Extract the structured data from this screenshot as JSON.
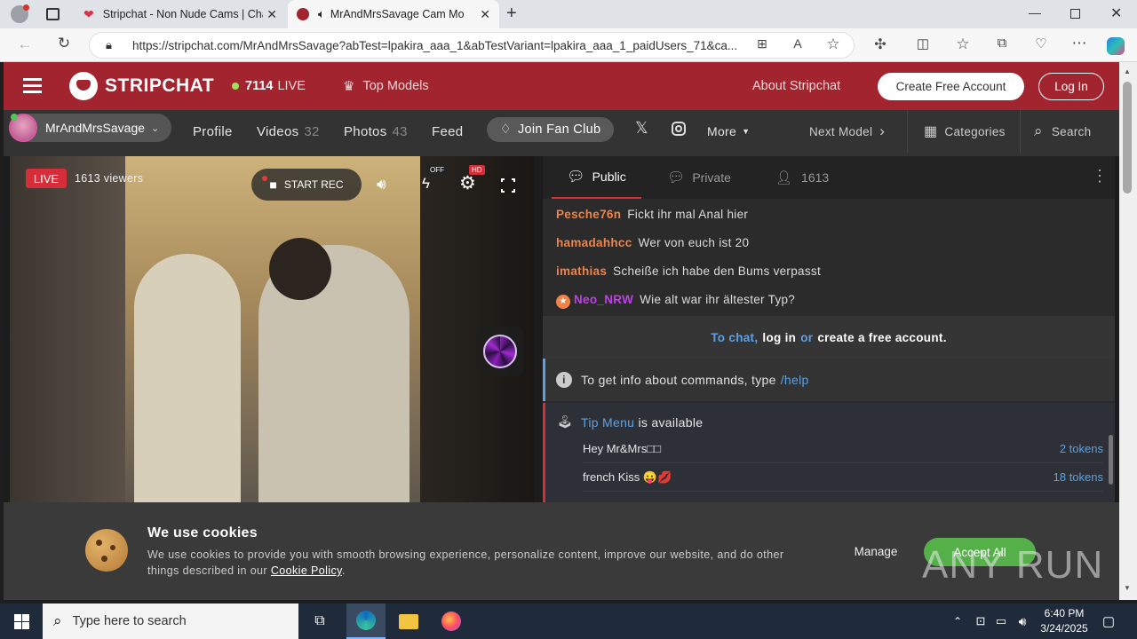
{
  "browser": {
    "tabs": [
      {
        "title": "Stripchat - Non Nude Cams | Cha"
      },
      {
        "title": "MrAndMrsSavage Cam Mod"
      }
    ],
    "url": "https://stripchat.com/MrAndMrsSavage?abTest=lpakira_aaa_1&abTestVariant=lpakira_aaa_1_paidUsers_71&ca..."
  },
  "header": {
    "logo": "STRIPCHAT",
    "live_count": "7114",
    "live_label": "LIVE",
    "top_models": "Top Models",
    "about": "About Stripchat",
    "create_account": "Create Free Account",
    "login": "Log In"
  },
  "subnav": {
    "model_name": "MrAndMrsSavage",
    "profile": "Profile",
    "videos": "Videos",
    "videos_count": "32",
    "photos": "Photos",
    "photos_count": "43",
    "feed": "Feed",
    "join_fan_club": "Join Fan Club",
    "more": "More",
    "next_model": "Next Model",
    "categories": "Categories",
    "search": "Search"
  },
  "video": {
    "live_badge": "LIVE",
    "viewers": "1613 viewers",
    "start_rec": "START REC",
    "off_badge": "OFF",
    "hd_badge": "HD"
  },
  "chat": {
    "tabs": {
      "public": "Public",
      "private": "Private",
      "users": "1613"
    },
    "messages": [
      {
        "nick": "Pesche76n",
        "text": "Fickt ihr mal Anal hier"
      },
      {
        "nick": "hamadahhcc",
        "text": "Wer von euch ist 20"
      },
      {
        "nick": "imathias",
        "text": "Scheiße ich habe den Bums verpasst"
      },
      {
        "nick": "Neo_NRW",
        "text": "Wie alt war ihr ältester Typ?"
      }
    ],
    "login_prompt": {
      "to_chat": "To chat,",
      "log_in": "log in",
      "or": "or",
      "create": "create a free account",
      "dot": "."
    },
    "info_text": "To get info about commands, type",
    "info_cmd": "/help",
    "tip_menu_link": "Tip Menu",
    "tip_menu_suffix": "is available",
    "tip_items": [
      {
        "name": "Hey Mr&Mrs□□",
        "price": "2 tokens"
      },
      {
        "name": "french Kiss 😛💋",
        "price": "18 tokens"
      }
    ]
  },
  "cookie": {
    "title": "We use cookies",
    "text": "We use cookies to provide you with smooth browsing experience, personalize content, improve our website, and do other things described in our",
    "policy_link": "Cookie Policy",
    "period": ".",
    "manage": "Manage",
    "accept": "Accept All"
  },
  "watermark": "ANY RUN",
  "taskbar": {
    "search_placeholder": "Type here to search",
    "time": "6:40 PM",
    "date": "3/24/2025"
  },
  "colors": {
    "brand_red": "#a2242f",
    "accept_green": "#56b04a",
    "live_red": "#d62d3a",
    "nick_orange": "#f0834a",
    "nick_purple": "#c040e8",
    "link_blue": "#5ea1e2"
  }
}
